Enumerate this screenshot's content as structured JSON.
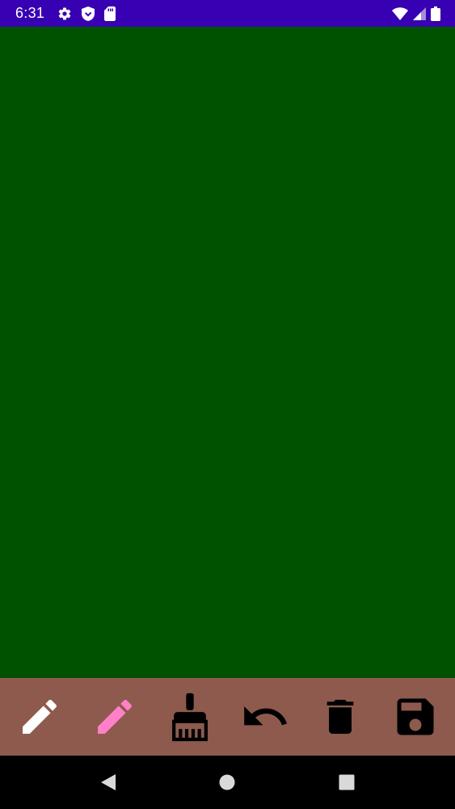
{
  "status_bar": {
    "time": "6:31",
    "background_color": "#3700B3",
    "left_icons": [
      "settings-icon",
      "shield-icon",
      "sd-card-icon"
    ],
    "right_icons": [
      "wifi-icon",
      "signal-icon",
      "battery-icon"
    ]
  },
  "canvas": {
    "background_color": "#005100"
  },
  "toolbar": {
    "background_color": "#8D5A4D",
    "tools": [
      {
        "icon": "pencil-icon",
        "color": "#FFFFFF"
      },
      {
        "icon": "pencil-icon",
        "color": "#FF80C8"
      },
      {
        "icon": "brush-icon",
        "color": "#000000"
      },
      {
        "icon": "undo-icon",
        "color": "#000000"
      },
      {
        "icon": "trash-icon",
        "color": "#000000"
      },
      {
        "icon": "save-icon",
        "color": "#000000"
      }
    ]
  },
  "nav_bar": {
    "buttons": [
      "back-icon",
      "home-icon",
      "recents-icon"
    ]
  }
}
